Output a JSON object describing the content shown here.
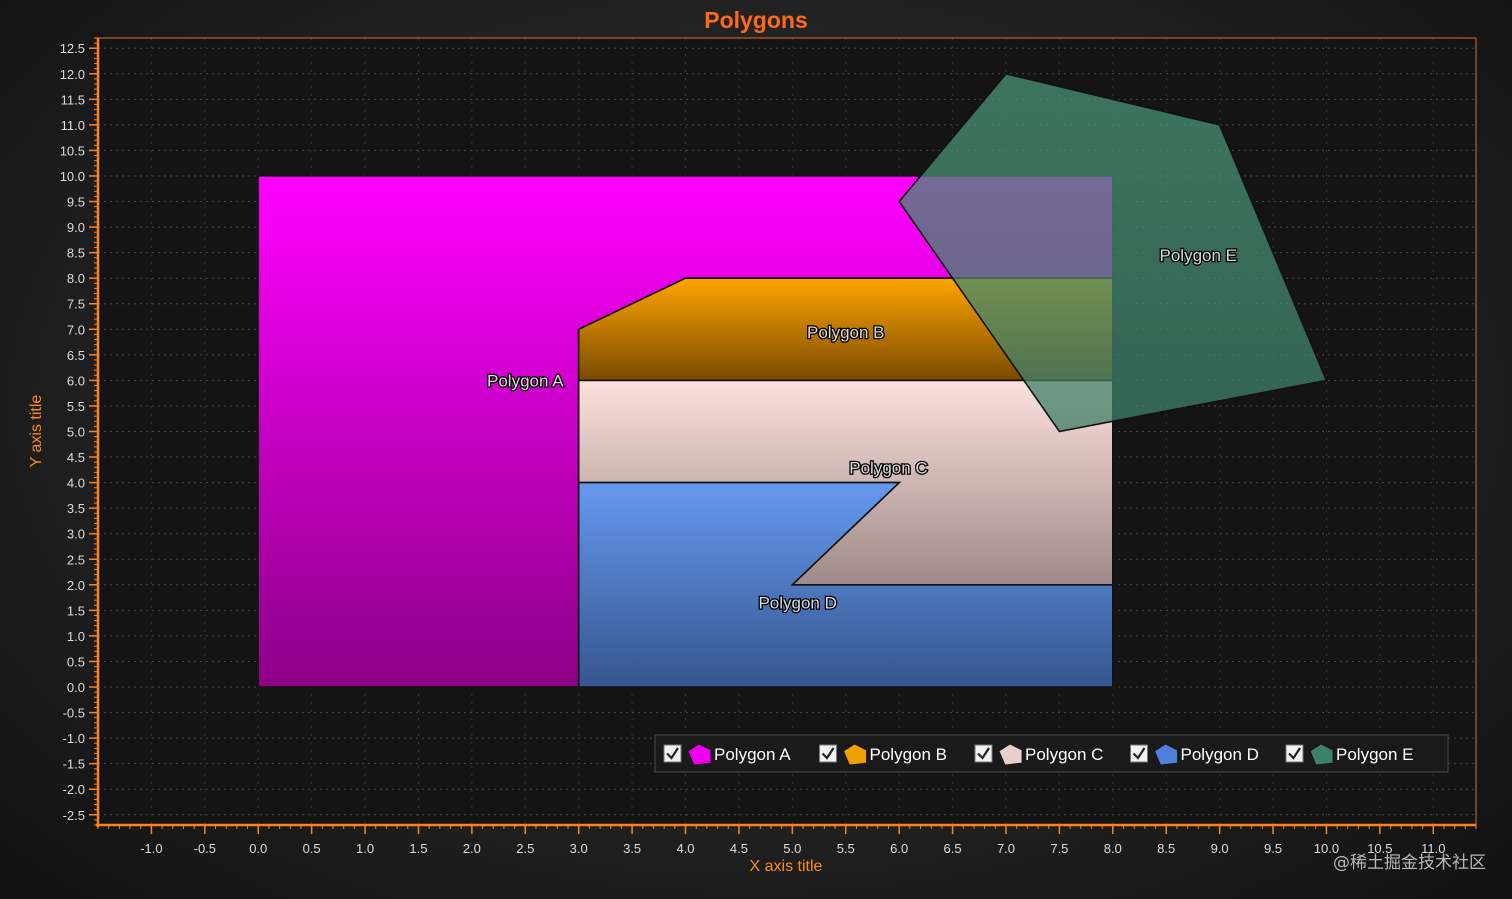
{
  "chart_data": {
    "type": "area",
    "title": "Polygons",
    "xlabel": "X axis title",
    "ylabel": "Y axis title",
    "xlim": [
      -1.5,
      11.4
    ],
    "ylim": [
      -2.7,
      12.7
    ],
    "xticks": [
      "-1.0",
      "-0.5",
      "0.0",
      "0.5",
      "1.0",
      "1.5",
      "2.0",
      "2.5",
      "3.0",
      "3.5",
      "4.0",
      "4.5",
      "5.0",
      "5.5",
      "6.0",
      "6.5",
      "7.0",
      "7.5",
      "8.0",
      "8.5",
      "9.0",
      "9.5",
      "10.0",
      "10.5",
      "11.0"
    ],
    "yticks": [
      "12.5",
      "12.0",
      "11.5",
      "11.0",
      "10.5",
      "10.0",
      "9.5",
      "9.0",
      "8.5",
      "8.0",
      "7.5",
      "7.0",
      "6.5",
      "6.0",
      "5.5",
      "5.0",
      "4.5",
      "4.0",
      "3.5",
      "3.0",
      "2.5",
      "2.0",
      "1.5",
      "1.0",
      "0.5",
      "0.0",
      "-0.5",
      "-1.0",
      "-1.5",
      "-2.0",
      "-2.5"
    ],
    "grid": true,
    "legend_position": "bottom-right",
    "series": [
      {
        "name": "Polygon A",
        "color_top": "#ff00ff",
        "color_bottom": "#8c0087",
        "opacity": 1,
        "points": [
          [
            0,
            0
          ],
          [
            0,
            10
          ],
          [
            8,
            10
          ],
          [
            8,
            8
          ],
          [
            4,
            8
          ],
          [
            3,
            7
          ],
          [
            3,
            0
          ]
        ],
        "label_at": [
          2.5,
          6.0
        ]
      },
      {
        "name": "Polygon B",
        "color_top": "#ffa500",
        "color_bottom": "#7a4a00",
        "opacity": 1,
        "points": [
          [
            3,
            6
          ],
          [
            3,
            7
          ],
          [
            4,
            8
          ],
          [
            8,
            8
          ],
          [
            8,
            6
          ]
        ],
        "label_at": [
          5.5,
          6.95
        ]
      },
      {
        "name": "Polygon C",
        "color_top": "#fde0dc",
        "color_bottom": "#9e8a88",
        "opacity": 1,
        "points": [
          [
            3,
            4
          ],
          [
            3,
            6
          ],
          [
            8,
            6
          ],
          [
            8,
            2
          ],
          [
            5,
            2
          ],
          [
            6,
            4
          ]
        ],
        "label_at": [
          5.9,
          4.3
        ]
      },
      {
        "name": "Polygon D",
        "color_top": "#6699ee",
        "color_bottom": "#35558e",
        "opacity": 1,
        "points": [
          [
            3,
            0
          ],
          [
            3,
            4
          ],
          [
            6,
            4
          ],
          [
            5,
            2
          ],
          [
            8,
            2
          ],
          [
            8,
            0
          ]
        ],
        "label_at": [
          5.05,
          1.65
        ]
      },
      {
        "name": "Polygon E",
        "color_top": "#4a9478",
        "color_bottom": "#3e7e68",
        "opacity": 0.75,
        "points": [
          [
            7,
            12
          ],
          [
            9,
            11
          ],
          [
            10,
            6
          ],
          [
            7.5,
            5
          ],
          [
            6,
            9.5
          ]
        ],
        "label_at": [
          8.8,
          8.45
        ]
      }
    ]
  },
  "legend": {
    "items": [
      {
        "label": "Polygon A",
        "color": "#ee00ee",
        "checked": true
      },
      {
        "label": "Polygon B",
        "color": "#f0a000",
        "checked": true
      },
      {
        "label": "Polygon C",
        "color": "#e8cfcc",
        "checked": true
      },
      {
        "label": "Polygon D",
        "color": "#4f7fd8",
        "checked": true
      },
      {
        "label": "Polygon E",
        "color": "#3d8068",
        "checked": true
      }
    ]
  },
  "watermark": "@稀土掘金技术社区"
}
